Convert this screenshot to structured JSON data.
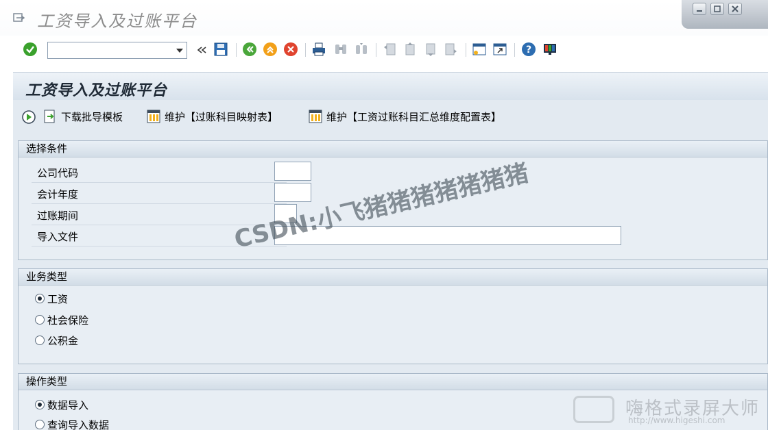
{
  "window": {
    "title": "工资导入及过账平台",
    "controls": [
      "minimize",
      "maximize",
      "close"
    ]
  },
  "toolbar": {
    "command_value": "",
    "icons": [
      "enter-icon",
      "collapse-icon",
      "save-icon",
      "back-icon",
      "exit-icon",
      "cancel-icon",
      "print-icon",
      "find-icon",
      "find-next-icon",
      "first-page-icon",
      "previous-page-icon",
      "next-page-icon",
      "last-page-icon",
      "new-session-icon",
      "shortcut-icon",
      "help-icon",
      "layout-icon"
    ]
  },
  "screen": {
    "title": "工资导入及过账平台"
  },
  "app_toolbar": {
    "download_template": "下载批导模板",
    "maintain_mapping": "维护【过账科目映射表】",
    "maintain_summary": "维护【工资过账科目汇总维度配置表】"
  },
  "selection": {
    "title": "选择条件",
    "fields": [
      {
        "label": "公司代码",
        "value": ""
      },
      {
        "label": "会计年度",
        "value": ""
      },
      {
        "label": "过账期间",
        "value": ""
      },
      {
        "label": "导入文件",
        "value": ""
      }
    ]
  },
  "business_type": {
    "title": "业务类型",
    "options": [
      {
        "label": "工资",
        "selected": true
      },
      {
        "label": "社会保险",
        "selected": false
      },
      {
        "label": "公积金",
        "selected": false
      }
    ]
  },
  "operation_type": {
    "title": "操作类型",
    "options": [
      {
        "label": "数据导入",
        "selected": true
      },
      {
        "label": "查询导入数据",
        "selected": false
      }
    ]
  },
  "overlay": {
    "watermark": "CSDN:小飞猪猪猪猪猪猪猪",
    "recorder_name": "嗨格式录屏大师",
    "recorder_url": "http://www.higeshi.com"
  },
  "colors": {
    "panel": "#e3eaf1",
    "group": "#e8eef4",
    "border": "#a9b8c8"
  }
}
